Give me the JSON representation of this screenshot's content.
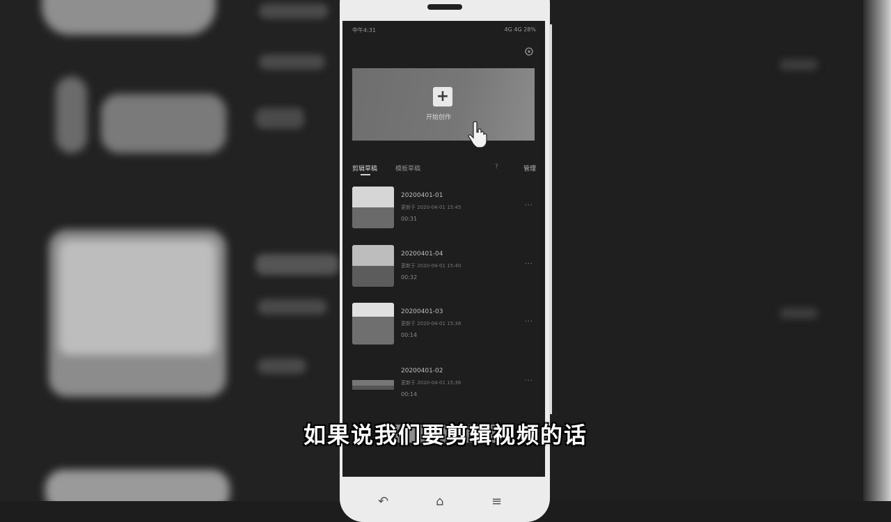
{
  "status_bar": {
    "time": "中午4:31",
    "indicators": "4G 4G 28%"
  },
  "hero": {
    "label": "开始创作"
  },
  "tabs": {
    "drafts": "剪辑草稿",
    "templates": "模板草稿",
    "help": "?",
    "manage": "管理"
  },
  "drafts": [
    {
      "title": "20200401-01",
      "meta": "更新于 2020-04-01 15:45",
      "duration": "00:31"
    },
    {
      "title": "20200401-04",
      "meta": "更新于 2020-04-01 15:40",
      "duration": "00:32"
    },
    {
      "title": "20200401-03",
      "meta": "更新于 2020-04-01 15:38",
      "duration": "00:14"
    },
    {
      "title": "20200401-02",
      "meta": "更新于 2020-04-01 15:36",
      "duration": "00:14"
    }
  ],
  "subtitle": "如果说我们要剪辑视频的话",
  "icons": {
    "settings": "gear-icon",
    "hand": "pointer-hand-icon",
    "more": "more-icon"
  },
  "colors": {
    "screen_bg": "#1e1e1e",
    "hero_bg": "#777777",
    "subtitle": "#ffffff"
  }
}
